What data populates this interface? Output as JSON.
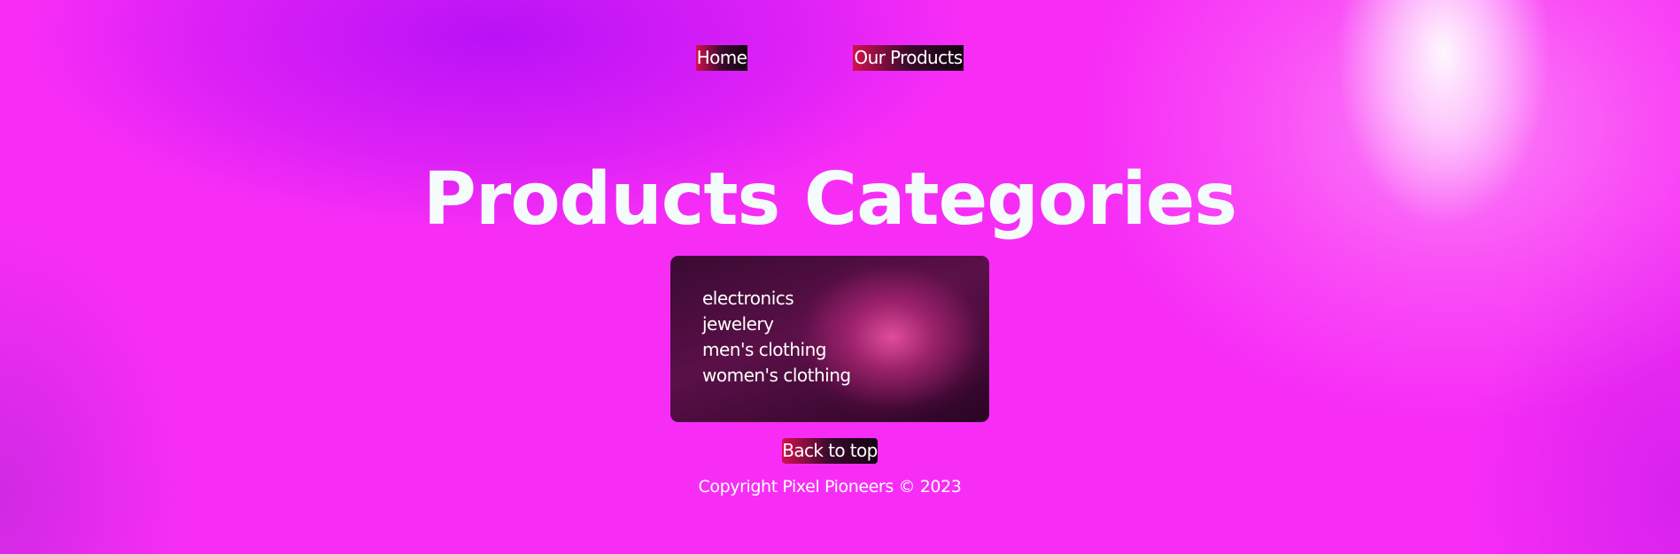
{
  "nav": {
    "home_label": "Home",
    "products_label": "Our Products"
  },
  "main": {
    "title": "Products Categories",
    "categories": [
      "electronics",
      "jewelery",
      "men's clothing",
      "women's clothing"
    ]
  },
  "footer": {
    "back_to_top_label": "Back to top",
    "copyright": "Copyright Pixel Pioneers © 2023"
  },
  "colors": {
    "background": "#f72df6",
    "button_gradient_start": "#d1124f",
    "button_gradient_end": "#120410",
    "card_background": "#3a0a32",
    "title_text": "#f4fbfb"
  }
}
